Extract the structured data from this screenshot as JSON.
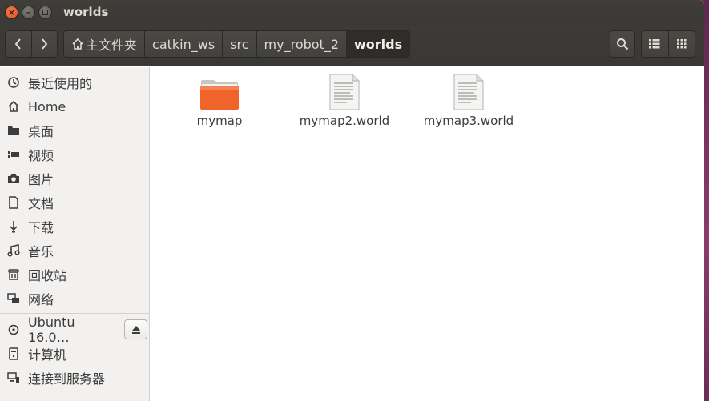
{
  "window": {
    "title": "worlds"
  },
  "nav": {
    "back": "‹",
    "forward": "›"
  },
  "breadcrumbs": [
    {
      "label": "主文件夹",
      "icon": "home-icon"
    },
    {
      "label": "catkin_ws"
    },
    {
      "label": "src"
    },
    {
      "label": "my_robot_2"
    },
    {
      "label": "worlds",
      "active": true
    }
  ],
  "toolbar": {
    "search_icon": "search-icon",
    "list_view_icon": "list-view-icon",
    "grid_view_icon": "grid-view-icon"
  },
  "sidebar": {
    "items": [
      {
        "label": "最近使用的",
        "icon": "recent-icon"
      },
      {
        "label": "Home",
        "icon": "home-icon"
      },
      {
        "label": "桌面",
        "icon": "desktop-icon"
      },
      {
        "label": "视频",
        "icon": "video-icon"
      },
      {
        "label": "图片",
        "icon": "camera-icon"
      },
      {
        "label": "文档",
        "icon": "document-icon"
      },
      {
        "label": "下载",
        "icon": "download-icon"
      },
      {
        "label": "音乐",
        "icon": "music-icon"
      },
      {
        "label": "回收站",
        "icon": "trash-icon"
      },
      {
        "label": "网络",
        "icon": "network-icon"
      }
    ],
    "devices": [
      {
        "label": "Ubuntu 16.0…",
        "icon": "disc-icon"
      },
      {
        "label": "计算机",
        "icon": "computer-icon"
      },
      {
        "label": "连接到服务器",
        "icon": "server-icon"
      }
    ]
  },
  "files": [
    {
      "name": "mymap",
      "type": "folder"
    },
    {
      "name": "mymap2.world",
      "type": "text-file"
    },
    {
      "name": "mymap3.world",
      "type": "text-file"
    }
  ],
  "colors": {
    "titlebar": "#3c3b37",
    "folder": "#f0642c",
    "sidebar": "#f2f1f0"
  }
}
